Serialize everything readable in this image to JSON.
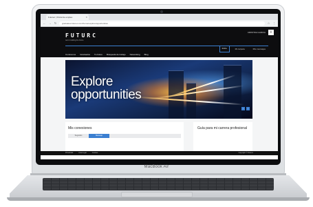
{
  "device": {
    "brand": "MacBook Air"
  },
  "browser": {
    "tab_title": "Futurec | Portal de empleo",
    "url": "graduates.futurec.com/home/explore/opportunities"
  },
  "site": {
    "logo": "FUTURC",
    "tagline": "we're building the future",
    "user_name": "CRISTINA GARCIA",
    "user_initial": "i",
    "top_links": [
      "Inicio",
      "Mi carpeta",
      "Mis mensajes"
    ],
    "nav": [
      "Conócenos",
      "Graduados",
      "Tu futuro",
      "Búsqueda de trabajo",
      "Networking",
      "Blog"
    ]
  },
  "hero": {
    "headline_line1": "Explore",
    "headline_line2": "opportunities",
    "prev": "‹",
    "next": "›"
  },
  "connections": {
    "title": "Mis conexiones",
    "tabs": [
      "Seguidos",
      "Mensaje"
    ]
  },
  "guide": {
    "title": "Guía para mi carrera profesional"
  },
  "footer": {
    "links": [
      "Privacidad",
      "Aviso legal",
      "Cookies"
    ],
    "copyright": "Copyright © Futurec"
  },
  "colors": {
    "accent": "#3b7fd1",
    "header_bg": "#0d0d0f"
  }
}
